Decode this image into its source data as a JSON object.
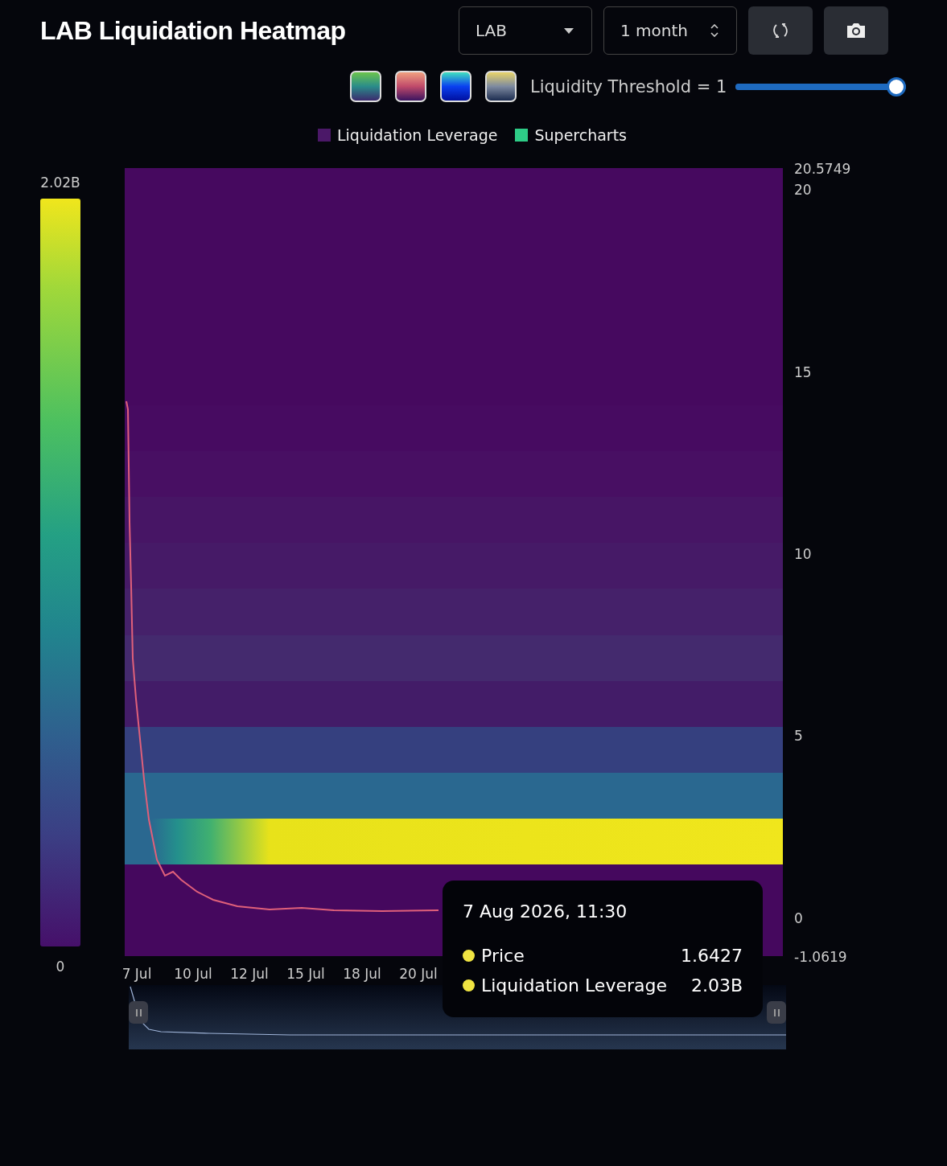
{
  "title": "LAB Liquidation Heatmap",
  "symbol_select": {
    "value": "LAB"
  },
  "period_select": {
    "value": "1 month"
  },
  "color_schemes": [
    {
      "kind": "viridis"
    },
    {
      "kind": "magma"
    },
    {
      "kind": "jet"
    },
    {
      "kind": "cividis"
    }
  ],
  "threshold": {
    "label": "Liquidity Threshold = 1",
    "level": 1
  },
  "legend": [
    {
      "label": "Liquidation Leverage",
      "color": "#4b1868"
    },
    {
      "label": "Supercharts",
      "color": "#2ecc87"
    }
  ],
  "color_scale": {
    "max": "2.02B",
    "min": "0"
  },
  "y_ticks": [
    "20.5749",
    "20",
    "15",
    "10",
    "5",
    "0",
    "-1.0619"
  ],
  "x_ticks": [
    "7 Jul",
    "10 Jul",
    "12 Jul",
    "15 Jul",
    "18 Jul",
    "20 Jul"
  ],
  "tooltip": {
    "time": "7 Aug 2026, 11:30",
    "rows": [
      {
        "label": "Price",
        "value": "1.6427",
        "color": "#f0e442"
      },
      {
        "label": "Liquidation Leverage",
        "value": "2.03B",
        "color": "#f0e442"
      }
    ]
  }
}
